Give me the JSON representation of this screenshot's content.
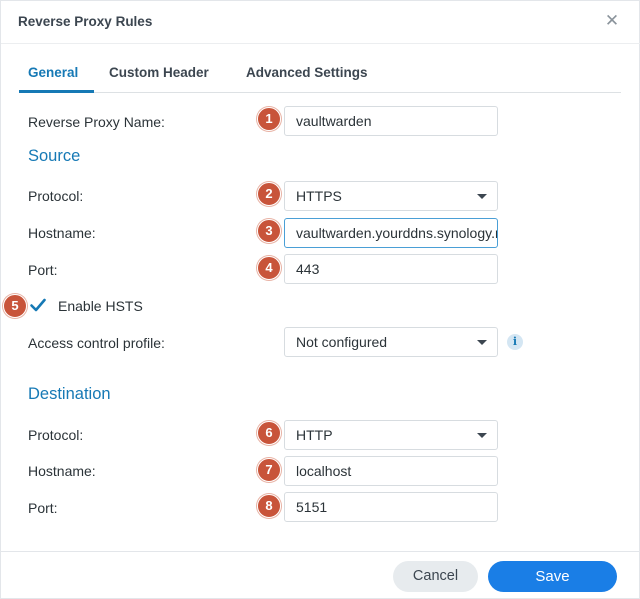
{
  "dialog": {
    "title": "Reverse Proxy Rules",
    "close_icon": "close-icon"
  },
  "tabs": [
    {
      "label": "General",
      "active": true
    },
    {
      "label": "Custom Header",
      "active": false
    },
    {
      "label": "Advanced Settings",
      "active": false
    }
  ],
  "general": {
    "name_label": "Reverse Proxy Name:",
    "name_value": "vaultwarden"
  },
  "source": {
    "heading": "Source",
    "protocol_label": "Protocol:",
    "protocol_value": "HTTPS",
    "hostname_label": "Hostname:",
    "hostname_value": "vaultwarden.yourddns.synology.me",
    "port_label": "Port:",
    "port_value": "443",
    "hsts_label": "Enable HSTS",
    "hsts_checked": true,
    "acp_label": "Access control profile:",
    "acp_value": "Not configured"
  },
  "destination": {
    "heading": "Destination",
    "protocol_label": "Protocol:",
    "protocol_value": "HTTP",
    "hostname_label": "Hostname:",
    "hostname_value": "localhost",
    "port_label": "Port:",
    "port_value": "5151"
  },
  "badges": [
    "1",
    "2",
    "3",
    "4",
    "5",
    "6",
    "7",
    "8"
  ],
  "buttons": {
    "cancel": "Cancel",
    "save": "Save"
  },
  "colors": {
    "accent": "#1679b5",
    "badge": "#c8543a",
    "save": "#1a7ee6"
  }
}
